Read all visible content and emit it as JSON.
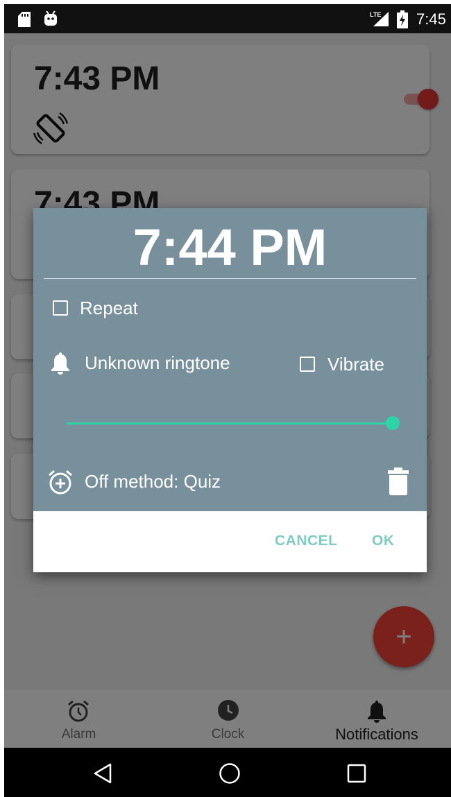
{
  "status_bar": {
    "time": "7:45",
    "network": "LTE"
  },
  "alarm_list": [
    {
      "time": "7:43 PM",
      "enabled": true
    },
    {
      "time": "7:43 PM"
    }
  ],
  "dialog": {
    "time": "7:44 PM",
    "repeat_label": "Repeat",
    "repeat_checked": false,
    "ringtone_label": "Unknown ringtone",
    "vibrate_label": "Vibrate",
    "vibrate_checked": false,
    "volume_fraction": 1.0,
    "off_method_label": "Off method: Quiz",
    "cancel_label": "CANCEL",
    "ok_label": "OK"
  },
  "fab": {
    "label": "+"
  },
  "bottom_nav": {
    "items": [
      {
        "label": "Alarm",
        "icon": "alarm-clock-icon"
      },
      {
        "label": "Clock",
        "icon": "clock-icon"
      },
      {
        "label": "Notifications",
        "icon": "bell-icon",
        "active": true
      }
    ]
  },
  "colors": {
    "dialog_header": "#78909c",
    "accent_teal": "#2fd3a8",
    "button_text": "#80cbc4",
    "fab": "#f44336"
  }
}
